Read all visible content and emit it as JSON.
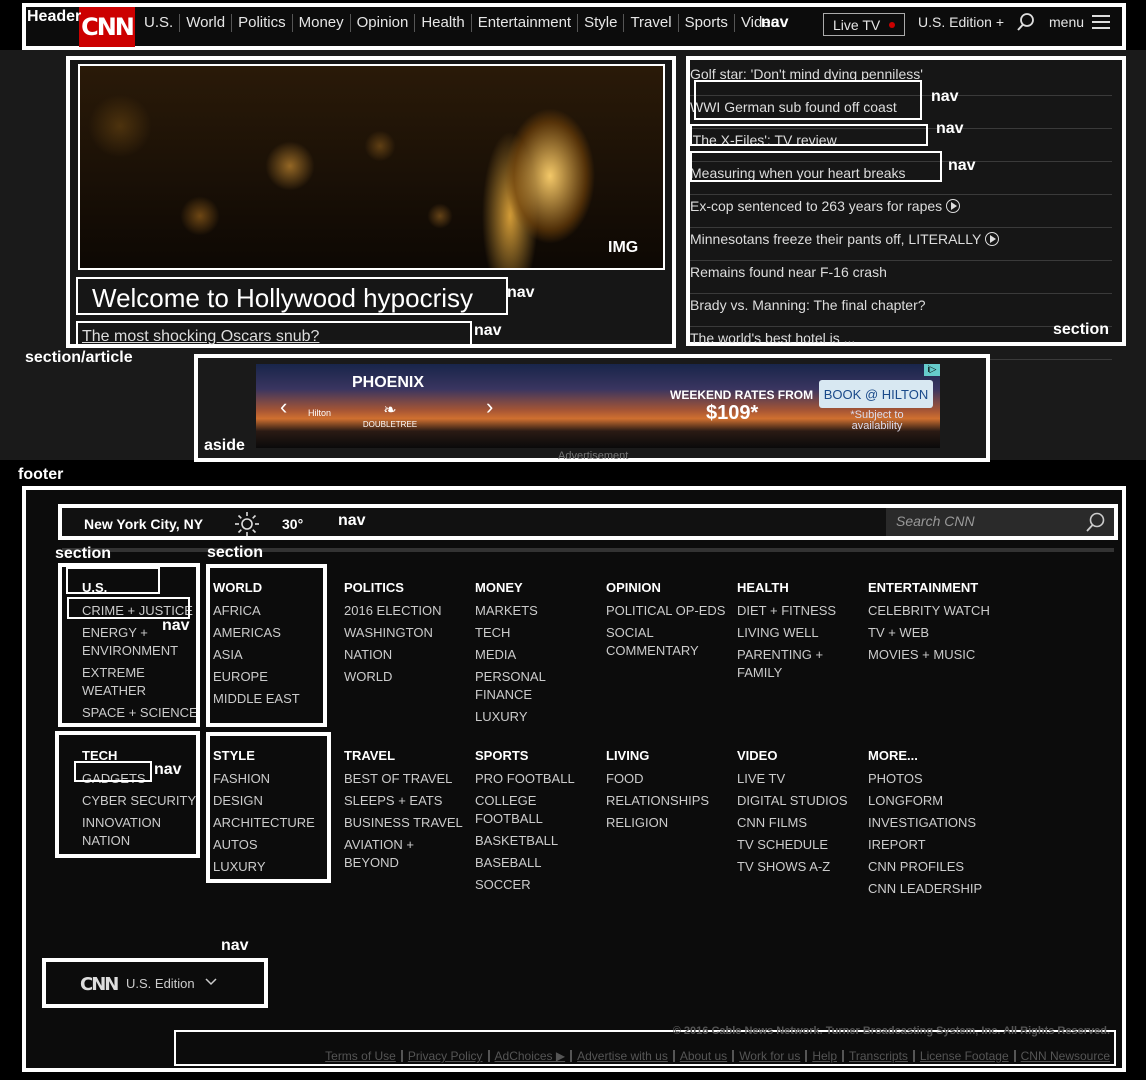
{
  "annotations": {
    "header": "Header",
    "nav": "nav",
    "img": "IMG",
    "section": "section",
    "section_article": "section/article",
    "aside": "aside",
    "footer": "footer"
  },
  "header": {
    "logo": "CNN",
    "nav_items": [
      "U.S.",
      "World",
      "Politics",
      "Money",
      "Opinion",
      "Health",
      "Entertainment",
      "Style",
      "Travel",
      "Sports",
      "Video"
    ],
    "live_tv": "Live TV",
    "edition": "U.S. Edition +",
    "menu": "menu"
  },
  "hero": {
    "title": "Welcome to Hollywood hypocrisy",
    "subtitle": "The most shocking Oscars snub?"
  },
  "headlines": [
    {
      "text": "Golf star: 'Don't mind dying penniless'",
      "video": false
    },
    {
      "text": "WWI German sub found off coast",
      "video": false
    },
    {
      "text": "'The X-Files': TV review",
      "video": false
    },
    {
      "text": "Measuring when your heart breaks",
      "video": false
    },
    {
      "text": "Ex-cop sentenced to 263 years for rapes",
      "video": true
    },
    {
      "text": "Minnesotans freeze their pants off, LITERALLY",
      "video": true
    },
    {
      "text": "Remains found near F-16 crash",
      "video": false
    },
    {
      "text": "Brady vs. Manning: The final chapter?",
      "video": false
    },
    {
      "text": "The world's best hotel is ...",
      "video": false
    }
  ],
  "ad": {
    "city": "PHOENIX",
    "rates": "WEEKEND RATES FROM",
    "price": "$109*",
    "book": "BOOK @ HILTON",
    "note": "*Subject to availability",
    "brand_hilton": "Hilton",
    "brand_doubletree": "DOUBLETREE",
    "label": "Advertisement"
  },
  "footer": {
    "city": "New York City, NY",
    "temp": "30°",
    "search_placeholder": "Search CNN",
    "columns_row1": [
      {
        "title": "U.S.",
        "items": [
          "CRIME + JUSTICE",
          "ENERGY + ENVIRONMENT",
          "EXTREME WEATHER",
          "SPACE + SCIENCE"
        ]
      },
      {
        "title": "WORLD",
        "items": [
          "AFRICA",
          "AMERICAS",
          "ASIA",
          "EUROPE",
          "MIDDLE EAST"
        ]
      },
      {
        "title": "POLITICS",
        "items": [
          "2016 ELECTION",
          "WASHINGTON",
          "NATION",
          "WORLD"
        ]
      },
      {
        "title": "MONEY",
        "items": [
          "MARKETS",
          "TECH",
          "MEDIA",
          "PERSONAL FINANCE",
          "LUXURY"
        ]
      },
      {
        "title": "OPINION",
        "items": [
          "POLITICAL OP-EDS",
          "SOCIAL COMMENTARY"
        ]
      },
      {
        "title": "HEALTH",
        "items": [
          "DIET + FITNESS",
          "LIVING WELL",
          "PARENTING + FAMILY"
        ]
      },
      {
        "title": "ENTERTAINMENT",
        "items": [
          "CELEBRITY WATCH",
          "TV + WEB",
          "MOVIES + MUSIC"
        ]
      }
    ],
    "columns_row2": [
      {
        "title": "TECH",
        "items": [
          "GADGETS",
          "CYBER SECURITY",
          "INNOVATION NATION"
        ]
      },
      {
        "title": "STYLE",
        "items": [
          "FASHION",
          "DESIGN",
          "ARCHITECTURE",
          "AUTOS",
          "LUXURY"
        ]
      },
      {
        "title": "TRAVEL",
        "items": [
          "BEST OF TRAVEL",
          "SLEEPS + EATS",
          "BUSINESS TRAVEL",
          "AVIATION + BEYOND"
        ]
      },
      {
        "title": "SPORTS",
        "items": [
          "PRO FOOTBALL",
          "COLLEGE FOOTBALL",
          "BASKETBALL",
          "BASEBALL",
          "SOCCER"
        ]
      },
      {
        "title": "LIVING",
        "items": [
          "FOOD",
          "RELATIONSHIPS",
          "RELIGION"
        ]
      },
      {
        "title": "VIDEO",
        "items": [
          "LIVE TV",
          "DIGITAL STUDIOS",
          "CNN FILMS",
          "TV SCHEDULE",
          "TV SHOWS A-Z"
        ]
      },
      {
        "title": "MORE...",
        "items": [
          "PHOTOS",
          "LONGFORM",
          "INVESTIGATIONS",
          "IREPORT",
          "CNN PROFILES",
          "CNN LEADERSHIP"
        ]
      }
    ],
    "logo": "CNN",
    "edition": "U.S. Edition",
    "copyright": "© 2016 Cable News Network. Turner Broadcasting System, Inc. All Rights Reserved.",
    "legal_links": [
      "Terms of Use",
      "Privacy Policy",
      "AdChoices ▶",
      "Advertise with us",
      "About us",
      "Work for us",
      "Help",
      "Transcripts",
      "License Footage",
      "CNN Newsource"
    ]
  }
}
